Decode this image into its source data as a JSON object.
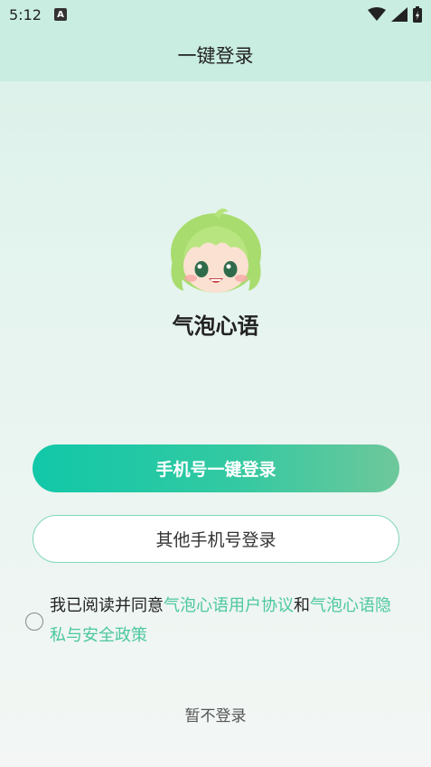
{
  "status_bar": {
    "time": "5:12",
    "notification_badge": "A",
    "icons": [
      "wifi-icon",
      "signal-icon",
      "battery-icon"
    ]
  },
  "header": {
    "title": "一键登录"
  },
  "app": {
    "avatar_icon": "girl-mascot-icon",
    "name": "气泡心语"
  },
  "actions": {
    "one_click_login": "手机号一键登录",
    "other_phone_login": "其他手机号登录",
    "skip_login": "暂不登录"
  },
  "agreement": {
    "checked": false,
    "prefix": "我已阅读并同意",
    "user_agreement": "气泡心语用户协议",
    "and": "和",
    "privacy_policy": "气泡心语隐私与安全政策"
  },
  "colors": {
    "accent": "#4cc7a0",
    "button_gradient_start": "#11c8a8",
    "button_gradient_end": "#6ec89b",
    "header_bg": "#c9ede0"
  }
}
